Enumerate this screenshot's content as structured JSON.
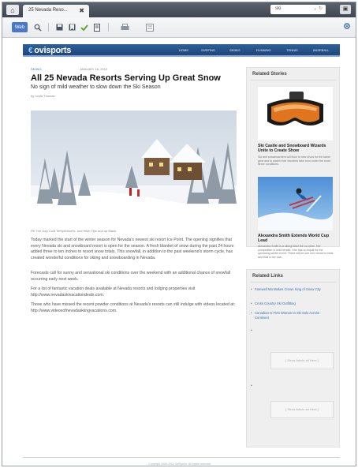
{
  "browser": {
    "tab_title": "25 Nevada Reso...",
    "tab_close": "✖",
    "address_text": "ski",
    "address_controls": "⌄ ↻",
    "corner_glyph": "▣",
    "toolbar_main_label": "Web",
    "home_glyph": "⌂"
  },
  "site": {
    "logo_swirl": "€",
    "logo_text": "ovisports",
    "nav": [
      "HOME",
      "SURFING",
      "SKIING",
      "RUNNING",
      "TENNIS",
      "BASEBALL"
    ]
  },
  "article": {
    "category": "SKIING",
    "date": "JANUARY 16, 2012",
    "headline": "All 25 Nevada Resorts Serving Up Great Snow",
    "subheadline": "No sign of mild weather to slow down the Ski Season",
    "byline": "by Linda Thomas",
    "caption": "Fill The Gap Cold Temperatures, and fresh Tips and up Blank",
    "paragraphs": [
      "Today marked the start of the winter season for Nevada's newest ski resort Ice Point. The opening signifies that every Nevada ski and snowboard resort is open for the season. A fresh blanket of snow during the past 24 hours added three to ten inches to resort snow totals. This snowfall, in addition to the past weekend's storm cycle, has created wonderful conditions for skiing and snowboarding in Nevada.",
      "Forecasts call for sunny and sensational ski conditions over the weekend with an additional chance of snowfall occurring early next week.",
      "For a list of fantastic vacation deals available at Nevada resorts and lodging properties visit http://www.nevadaskivacationdeals.com.",
      "Those who have missed the recent powder conditions at Nevada's resorts can still indulge with videos located at: http://www.videosofnevadaskiingvacations.com."
    ]
  },
  "sidebar": {
    "related_stories_title": "Related Stories",
    "stories": [
      {
        "title": "Ski Castle and Snowboard Wizards Unite to Create Show",
        "text": "Ski and snowboarders will flock to new show for the latest gear and to watch their favorites take runs under the most fierce conditions."
      },
      {
        "title": "Alexandra Smith Extends World Cup Lead",
        "text": "Alexandra Smith is a skiing biker the no other. Her competition is until herself. She has no equal for the upcoming winter event. There will be one one record to beat and that is her own."
      }
    ],
    "related_links_title": "Related Links",
    "links": [
      "Farewell Ma Makes Crown King of Snow City",
      "Cross Country Ski Outfitting",
      "Canadian Is First Woman to Ski Solo Across Continent"
    ],
    "ads": [
      "[ Show Article ad Here ]",
      "[ Show Article ad Here ]"
    ]
  },
  "footer": {
    "copyright": "Copyright 2009-2012 OviSports. All rights reserved."
  }
}
